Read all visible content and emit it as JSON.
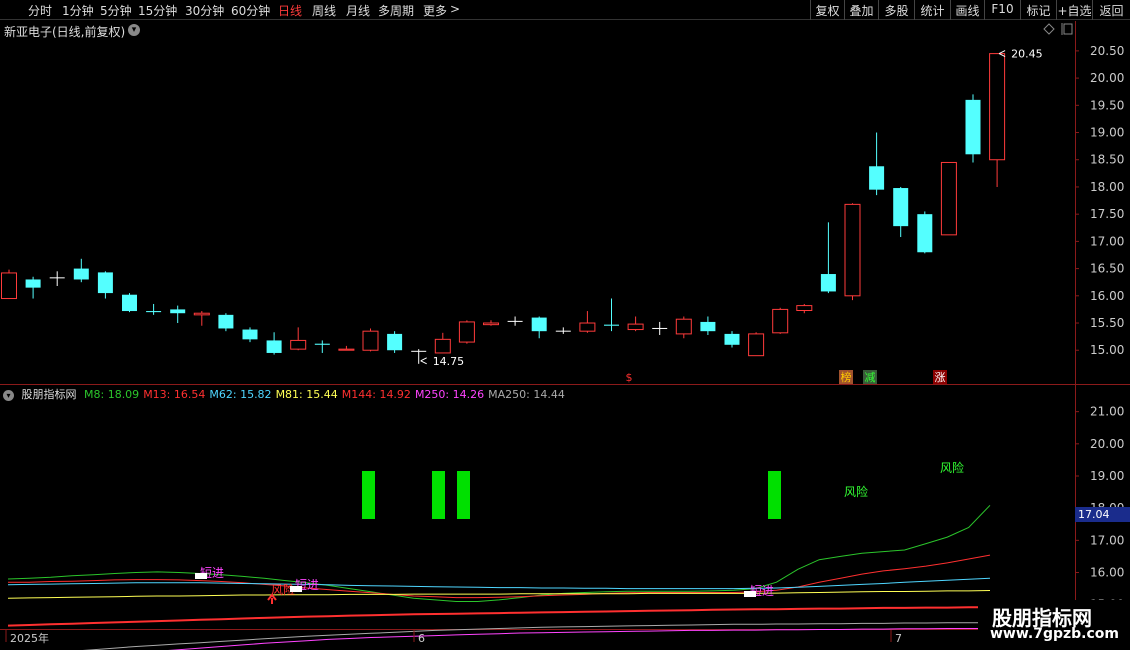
{
  "toolbar": {
    "periods": [
      "分时",
      "1分钟",
      "5分钟",
      "15分钟",
      "30分钟",
      "60分钟",
      "日线",
      "周线",
      "月线",
      "多周期",
      "更多"
    ],
    "active": "日线",
    "more_arrow": ">",
    "right_buttons": [
      "复权",
      "叠加",
      "多股",
      "统计",
      "画线",
      "F10",
      "标记",
      "+自选",
      "返回"
    ]
  },
  "main_chart": {
    "title": "新亚电子(日线,前复权)",
    "price_ticks": [
      "20.50",
      "20.00",
      "19.50",
      "19.00",
      "18.50",
      "18.00",
      "17.50",
      "17.00",
      "16.50",
      "16.00",
      "15.50",
      "15.00"
    ],
    "high_label": "20.45",
    "low_label": "14.75",
    "markers": [
      {
        "text": "$",
        "color": "#ff3030"
      },
      {
        "text": "榜",
        "color": "#ffcc00"
      },
      {
        "text": "减",
        "color": "#33ff33"
      },
      {
        "text": "涨",
        "color": "#ffffff"
      }
    ]
  },
  "indicator": {
    "name": "股朋指标网",
    "legend": [
      {
        "label": "M8: 18.09",
        "color": "#2bc52b"
      },
      {
        "label": "M13: 16.54",
        "color": "#ff3030"
      },
      {
        "label": "M62: 15.82",
        "color": "#4fd6ff"
      },
      {
        "label": "M81: 15.44",
        "color": "#ffff55"
      },
      {
        "label": "M144: 14.92",
        "color": "#ff3030"
      },
      {
        "label": "M250: 14.26",
        "color": "#ff44ff"
      },
      {
        "label": "MA250: 14.44",
        "color": "#aaaaaa"
      }
    ],
    "y_ticks": [
      "21.00",
      "20.00",
      "19.00",
      "18.00",
      "17.00",
      "16.00",
      "15.00"
    ],
    "current_value": "17.04",
    "annotations": [
      {
        "text": "风险",
        "color": "#33ff33"
      },
      {
        "text": "风险",
        "color": "#33ff33"
      },
      {
        "text": "短进",
        "color": "#ff44ff"
      },
      {
        "text": "短进",
        "color": "#ff44ff"
      },
      {
        "text": "短进",
        "color": "#ff44ff"
      },
      {
        "text": "风险",
        "color": "#ff3030"
      }
    ]
  },
  "date_axis": {
    "labels": [
      "2025年",
      "6",
      "7"
    ]
  },
  "watermark": {
    "title": "股朋指标网",
    "url": "www.7gpzb.com"
  },
  "colors": {
    "up": "#ff3b3b",
    "down": "#54ffff",
    "background": "#000000"
  },
  "chart_data": {
    "type": "candlestick",
    "title": "新亚电子(日线,前复权)",
    "ylim": [
      14.6,
      20.7
    ],
    "candles": [
      {
        "o": 15.95,
        "c": 16.42,
        "h": 16.48,
        "l": 15.95
      },
      {
        "o": 16.3,
        "c": 16.15,
        "h": 16.35,
        "l": 15.95
      },
      {
        "o": 16.33,
        "c": 16.33,
        "h": 16.45,
        "l": 16.18
      },
      {
        "o": 16.5,
        "c": 16.3,
        "h": 16.68,
        "l": 16.25
      },
      {
        "o": 16.43,
        "c": 16.05,
        "h": 16.45,
        "l": 15.95
      },
      {
        "o": 16.02,
        "c": 15.72,
        "h": 16.05,
        "l": 15.7
      },
      {
        "o": 15.72,
        "c": 15.7,
        "h": 15.85,
        "l": 15.65
      },
      {
        "o": 15.75,
        "c": 15.68,
        "h": 15.82,
        "l": 15.5
      },
      {
        "o": 15.65,
        "c": 15.68,
        "h": 15.72,
        "l": 15.45
      },
      {
        "o": 15.65,
        "c": 15.4,
        "h": 15.68,
        "l": 15.35
      },
      {
        "o": 15.38,
        "c": 15.2,
        "h": 15.42,
        "l": 15.15
      },
      {
        "o": 15.18,
        "c": 14.95,
        "h": 15.33,
        "l": 14.92
      },
      {
        "o": 15.02,
        "c": 15.18,
        "h": 15.42,
        "l": 15.0
      },
      {
        "o": 15.12,
        "c": 15.1,
        "h": 15.18,
        "l": 14.95
      },
      {
        "o": 15.0,
        "c": 15.02,
        "h": 15.08,
        "l": 15.0
      },
      {
        "o": 15.0,
        "c": 15.35,
        "h": 15.4,
        "l": 14.98
      },
      {
        "o": 15.3,
        "c": 15.0,
        "h": 15.35,
        "l": 14.95
      },
      {
        "o": 14.98,
        "c": 14.98,
        "h": 15.02,
        "l": 14.75
      },
      {
        "o": 14.95,
        "c": 15.2,
        "h": 15.32,
        "l": 14.95
      },
      {
        "o": 15.15,
        "c": 15.52,
        "h": 15.55,
        "l": 15.12
      },
      {
        "o": 15.47,
        "c": 15.5,
        "h": 15.55,
        "l": 15.45
      },
      {
        "o": 15.53,
        "c": 15.53,
        "h": 15.62,
        "l": 15.45
      },
      {
        "o": 15.6,
        "c": 15.35,
        "h": 15.62,
        "l": 15.22
      },
      {
        "o": 15.35,
        "c": 15.35,
        "h": 15.42,
        "l": 15.3
      },
      {
        "o": 15.35,
        "c": 15.5,
        "h": 15.72,
        "l": 15.32
      },
      {
        "o": 15.47,
        "c": 15.45,
        "h": 15.95,
        "l": 15.35
      },
      {
        "o": 15.38,
        "c": 15.48,
        "h": 15.62,
        "l": 15.35
      },
      {
        "o": 15.4,
        "c": 15.4,
        "h": 15.52,
        "l": 15.28
      },
      {
        "o": 15.3,
        "c": 15.57,
        "h": 15.62,
        "l": 15.22
      },
      {
        "o": 15.52,
        "c": 15.35,
        "h": 15.62,
        "l": 15.28
      },
      {
        "o": 15.3,
        "c": 15.1,
        "h": 15.35,
        "l": 15.05
      },
      {
        "o": 14.9,
        "c": 15.3,
        "h": 15.33,
        "l": 14.9
      },
      {
        "o": 15.32,
        "c": 15.75,
        "h": 15.78,
        "l": 15.3
      },
      {
        "o": 15.73,
        "c": 15.82,
        "h": 15.85,
        "l": 15.68
      },
      {
        "o": 16.4,
        "c": 16.08,
        "h": 17.35,
        "l": 16.05
      },
      {
        "o": 16.0,
        "c": 17.68,
        "h": 17.7,
        "l": 15.92
      },
      {
        "o": 18.38,
        "c": 17.95,
        "h": 19.0,
        "l": 17.85
      },
      {
        "o": 17.98,
        "c": 17.28,
        "h": 18.0,
        "l": 17.08
      },
      {
        "o": 17.5,
        "c": 16.8,
        "h": 17.55,
        "l": 16.78
      },
      {
        "o": 17.12,
        "c": 18.45,
        "h": 18.45,
        "l": 17.12
      },
      {
        "o": 19.6,
        "c": 18.6,
        "h": 19.7,
        "l": 18.45
      },
      {
        "o": 18.5,
        "c": 20.45,
        "h": 20.45,
        "l": 18.0
      }
    ],
    "indicator_ylim": [
      14.4,
      21.3
    ],
    "indicator_series": [
      {
        "name": "M8",
        "color": "#2bc52b",
        "values": [
          15.8,
          15.82,
          15.85,
          15.9,
          15.93,
          15.97,
          16.0,
          16.02,
          16.0,
          15.97,
          15.93,
          15.88,
          15.82,
          15.75,
          15.68,
          15.6,
          15.5,
          15.4,
          15.3,
          15.2,
          15.15,
          15.1,
          15.1,
          15.15,
          15.22,
          15.3,
          15.35,
          15.38,
          15.4,
          15.42,
          15.42,
          15.42,
          15.42,
          15.43,
          15.45,
          15.5,
          15.7,
          16.1,
          16.4,
          16.5,
          16.6,
          16.65,
          16.7,
          16.9,
          17.1,
          17.4,
          18.09
        ]
      },
      {
        "name": "M13",
        "color": "#ff3030",
        "values": [
          15.7,
          15.7,
          15.72,
          15.73,
          15.75,
          15.77,
          15.78,
          15.78,
          15.77,
          15.75,
          15.72,
          15.68,
          15.63,
          15.58,
          15.52,
          15.47,
          15.42,
          15.37,
          15.32,
          15.27,
          15.25,
          15.22,
          15.22,
          15.23,
          15.25,
          15.28,
          15.3,
          15.32,
          15.35,
          15.37,
          15.38,
          15.38,
          15.38,
          15.38,
          15.38,
          15.4,
          15.45,
          15.55,
          15.7,
          15.82,
          15.95,
          16.05,
          16.12,
          16.2,
          16.3,
          16.42,
          16.54
        ]
      },
      {
        "name": "M62",
        "color": "#4fd6ff",
        "values": [
          15.62,
          15.63,
          15.64,
          15.65,
          15.66,
          15.67,
          15.68,
          15.68,
          15.68,
          15.68,
          15.67,
          15.66,
          15.65,
          15.64,
          15.63,
          15.62,
          15.6,
          15.59,
          15.58,
          15.57,
          15.56,
          15.55,
          15.54,
          15.53,
          15.53,
          15.52,
          15.52,
          15.51,
          15.51,
          15.5,
          15.5,
          15.5,
          15.5,
          15.5,
          15.5,
          15.51,
          15.52,
          15.54,
          15.57,
          15.6,
          15.63,
          15.66,
          15.7,
          15.73,
          15.76,
          15.79,
          15.82
        ]
      },
      {
        "name": "M81",
        "color": "#ffff55",
        "values": [
          15.2,
          15.21,
          15.22,
          15.23,
          15.24,
          15.25,
          15.26,
          15.27,
          15.27,
          15.28,
          15.29,
          15.3,
          15.3,
          15.31,
          15.31,
          15.31,
          15.32,
          15.32,
          15.32,
          15.33,
          15.33,
          15.33,
          15.33,
          15.33,
          15.34,
          15.34,
          15.34,
          15.34,
          15.34,
          15.34,
          15.35,
          15.35,
          15.35,
          15.35,
          15.35,
          15.35,
          15.36,
          15.37,
          15.38,
          15.39,
          15.4,
          15.41,
          15.41,
          15.42,
          15.43,
          15.43,
          15.44
        ]
      },
      {
        "name": "M144",
        "color": "#ff3030",
        "values": [
          14.35,
          14.37,
          14.39,
          14.41,
          14.43,
          14.45,
          14.47,
          14.49,
          14.51,
          14.53,
          14.55,
          14.57,
          14.59,
          14.61,
          14.63,
          14.64,
          14.66,
          14.67,
          14.69,
          14.7,
          14.71,
          14.72,
          14.73,
          14.74,
          14.75,
          14.76,
          14.77,
          14.78,
          14.79,
          14.8,
          14.81,
          14.82,
          14.83,
          14.84,
          14.85,
          14.86,
          14.86,
          14.87,
          14.88,
          14.88,
          14.89,
          14.9,
          14.9,
          14.91,
          14.91,
          14.92,
          14.92
        ]
      },
      {
        "name": "M250",
        "color": "#ff44ff",
        "values": [
          13.2,
          13.25,
          13.3,
          13.35,
          13.4,
          13.45,
          13.5,
          13.55,
          13.6,
          13.65,
          13.7,
          13.75,
          13.8,
          13.84,
          13.88,
          13.92,
          13.95,
          13.98,
          14.0,
          14.02,
          14.04,
          14.06,
          14.08,
          14.1,
          14.12,
          14.13,
          14.14,
          14.15,
          14.16,
          14.17,
          14.18,
          14.19,
          14.2,
          14.2,
          14.21,
          14.21,
          14.22,
          14.22,
          14.23,
          14.23,
          14.24,
          14.24,
          14.25,
          14.25,
          14.26,
          14.26,
          14.26
        ]
      },
      {
        "name": "MA250",
        "color": "#aaaaaa",
        "values": [
          13.4,
          13.45,
          13.5,
          13.55,
          13.6,
          13.65,
          13.7,
          13.74,
          13.78,
          13.82,
          13.86,
          13.9,
          13.94,
          13.98,
          14.02,
          14.05,
          14.08,
          14.11,
          14.14,
          14.17,
          14.2,
          14.22,
          14.24,
          14.26,
          14.28,
          14.3,
          14.31,
          14.32,
          14.33,
          14.34,
          14.35,
          14.36,
          14.37,
          14.38,
          14.39,
          14.39,
          14.4,
          14.4,
          14.41,
          14.41,
          14.42,
          14.42,
          14.43,
          14.43,
          14.44,
          14.44,
          14.44
        ]
      }
    ]
  }
}
